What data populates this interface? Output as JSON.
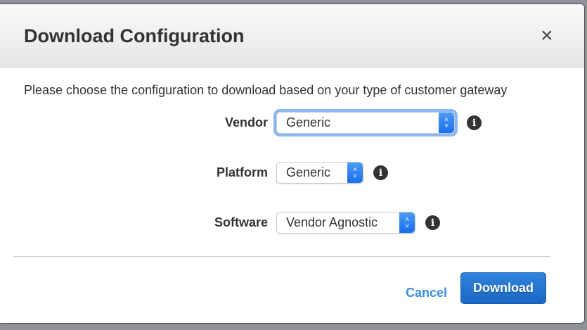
{
  "dialog": {
    "title": "Download Configuration",
    "close_icon": "×",
    "intro": "Please choose the configuration to download based on your type of customer gateway"
  },
  "fields": [
    {
      "label": "Vendor",
      "value": "Generic"
    },
    {
      "label": "Platform",
      "value": "Generic"
    },
    {
      "label": "Software",
      "value": "Vendor Agnostic"
    }
  ],
  "info_glyph": "i",
  "buttons": {
    "cancel": "Cancel",
    "download": "Download"
  },
  "colors": {
    "accent": "#1a6ef0",
    "link": "#3a8fe0"
  }
}
